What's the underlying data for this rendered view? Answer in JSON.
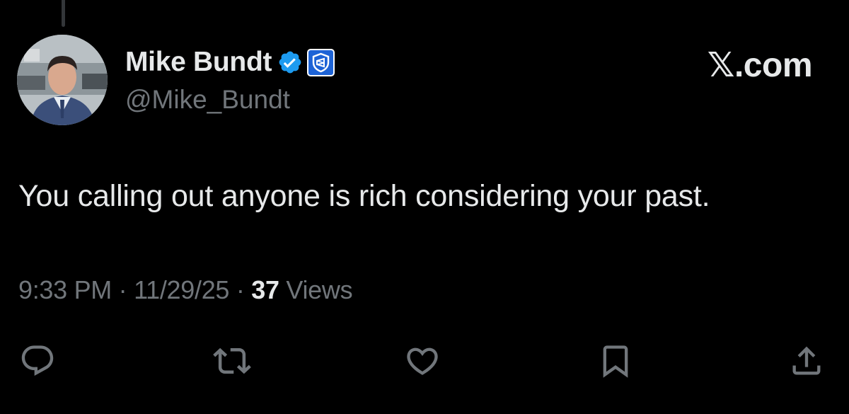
{
  "tweet": {
    "author": {
      "display_name": "Mike Bundt",
      "handle": "@Mike_Bundt",
      "avatar_icon": "user-avatar-photo",
      "verified_icon": "verified-badge-icon",
      "affiliate_icon": "affiliate-shield-icon"
    },
    "source_label": {
      "x_glyph": "𝕏",
      "domain": ".com"
    },
    "text": "You calling out anyone is rich considering your past.",
    "meta": {
      "time": "9:33 PM",
      "separator": "·",
      "date": "11/29/25",
      "views_count": "37",
      "views_label": "Views"
    },
    "actions": [
      {
        "name": "reply",
        "icon": "reply-icon"
      },
      {
        "name": "repost",
        "icon": "repost-icon"
      },
      {
        "name": "like",
        "icon": "heart-icon"
      },
      {
        "name": "bookmark",
        "icon": "bookmark-icon"
      },
      {
        "name": "share",
        "icon": "share-icon"
      }
    ]
  },
  "colors": {
    "background": "#000000",
    "primary_text": "#e7e9ea",
    "secondary_text": "#71767b",
    "verified_blue": "#1d9bf0",
    "affiliate_blue": "#1d63d6",
    "thread_line": "#333639"
  }
}
